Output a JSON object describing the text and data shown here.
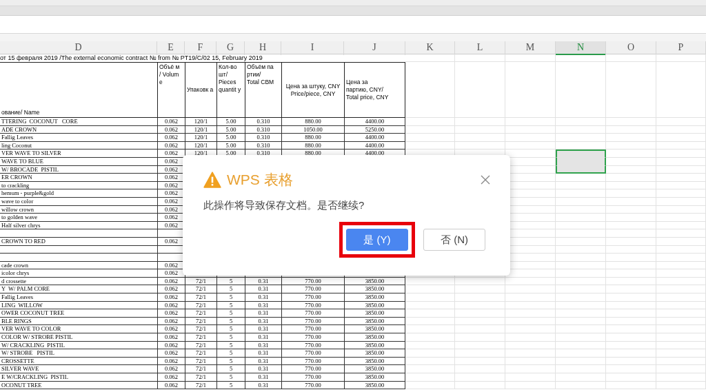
{
  "sheet": {
    "columns": [
      {
        "label": "D",
        "selected": false
      },
      {
        "label": "E",
        "selected": false
      },
      {
        "label": "F",
        "selected": false
      },
      {
        "label": "G",
        "selected": false
      },
      {
        "label": "H",
        "selected": false
      },
      {
        "label": "I",
        "selected": false
      },
      {
        "label": "J",
        "selected": false
      },
      {
        "label": "K",
        "selected": false
      },
      {
        "label": "L",
        "selected": false
      },
      {
        "label": "M",
        "selected": false
      },
      {
        "label": "N",
        "selected": true
      },
      {
        "label": "O",
        "selected": false
      },
      {
        "label": "P",
        "selected": false
      }
    ],
    "title_row": "от 15 февраля 2019 /The external economic contract №  from № PT19/C/02 15, February 2019",
    "headers": [
      "ование/ Name",
      "Объё м\n/ Volum\ne",
      "Упаковк а",
      "Кол-во\nшт/\nPieces\nquantit y",
      "Объём па\nртии/\nTotal CBM",
      "Цена за штуку, CNY\nPrice/piece, CNY",
      "Цена за\nпартию, CNY/\nTotal price, CNY"
    ],
    "rows": [
      {
        "cells": [
          "TTERING  COCONUT   CORE",
          "0.062",
          "120/1",
          "5.00",
          "0.310",
          "880.00",
          "4400.00"
        ],
        "selected": false
      },
      {
        "cells": [
          "ADE CROWN",
          "0.062",
          "120/1",
          "5.00",
          "0.310",
          "1050.00",
          "5250.00"
        ],
        "selected": false
      },
      {
        "cells": [
          "Fallig Leaves",
          "0.062",
          "120/1",
          "5.00",
          "0.310",
          "880.00",
          "4400.00"
        ],
        "selected": false
      },
      {
        "cells": [
          "ling Coconut",
          "0.062",
          "120/1",
          "5.00",
          "0.310",
          "880.00",
          "4400.00"
        ],
        "selected": false
      },
      {
        "cells": [
          "VER WAVE TO SILVER",
          "0.062",
          "120/1",
          "5.00",
          "0.310",
          "880.00",
          "4400.00"
        ],
        "selected": true
      },
      {
        "cells": [
          "WAVE TO BLUE",
          "0.062"
        ],
        "selected": true
      },
      {
        "cells": [
          "W/ BROCADE  PISTIL",
          "0.062"
        ],
        "selected": true
      },
      {
        "cells": [
          "ER CROWN",
          "0.062"
        ],
        "selected": false
      },
      {
        "cells": [
          "to crackling",
          "0.062"
        ],
        "selected": false
      },
      {
        "cells": [
          "hemum - purple&gold",
          "0.062"
        ],
        "selected": false
      },
      {
        "cells": [
          "wave to color",
          "0.062"
        ],
        "selected": false
      },
      {
        "cells": [
          "willow crown",
          "0.062"
        ],
        "selected": false
      },
      {
        "cells": [
          "to golden wave",
          "0.062"
        ],
        "selected": false
      },
      {
        "cells": [
          "Half silver chrys",
          "0.062"
        ],
        "selected": false
      },
      {
        "selected": false
      },
      {
        "cells": [
          "CROWN TO RED",
          "0.062"
        ],
        "selected": false
      },
      {
        "selected": false
      },
      {
        "selected": false
      },
      {
        "cells": [
          "cade crown",
          "0.062"
        ],
        "selected": false
      },
      {
        "cells": [
          "icolor chrys",
          "0.062"
        ],
        "selected": false
      },
      {
        "cells": [
          "d crossette",
          "0.062",
          "72/1",
          "5",
          "0.31",
          "770.00",
          "3850.00"
        ],
        "selected": false
      },
      {
        "cells": [
          "Y  W/ PALM CORE",
          "0.062",
          "72/1",
          "5",
          "0.31",
          "770.00",
          "3850.00"
        ],
        "selected": false
      },
      {
        "cells": [
          "Fallig Leaves",
          "0.062",
          "72/1",
          "5",
          "0.31",
          "770.00",
          "3850.00"
        ],
        "selected": false
      },
      {
        "cells": [
          "LING  WILLOW",
          "0.062",
          "72/1",
          "5",
          "0.31",
          "770.00",
          "3850.00"
        ],
        "selected": false
      },
      {
        "cells": [
          "OWER COCONUT TREE",
          "0.062",
          "72/1",
          "5",
          "0.31",
          "770.00",
          "3850.00"
        ],
        "selected": false
      },
      {
        "cells": [
          "BLE RINGS",
          "0.062",
          "72/1",
          "5",
          "0.31",
          "770.00",
          "3850.00"
        ],
        "selected": false
      },
      {
        "cells": [
          "VER WAVE TO COLOR",
          "0.062",
          "72/1",
          "5",
          "0.31",
          "770.00",
          "3850.00"
        ],
        "selected": false
      },
      {
        "cells": [
          "COLOR W/ STROBE PISTIL",
          "0.062",
          "72/1",
          "5",
          "0.31",
          "770.00",
          "3850.00"
        ],
        "selected": false
      },
      {
        "cells": [
          "W/ CRACKLING  PISTIL",
          "0.062",
          "72/1",
          "5",
          "0.31",
          "770.00",
          "3850.00"
        ],
        "selected": false
      },
      {
        "cells": [
          "W/ STROBE   PISTIL",
          "0.062",
          "72/1",
          "5",
          "0.31",
          "770.00",
          "3850.00"
        ],
        "selected": false
      },
      {
        "cells": [
          "CROSSETTE",
          "0.062",
          "72/1",
          "5",
          "0.31",
          "770.00",
          "3850.00"
        ],
        "selected": false
      },
      {
        "cells": [
          "SILVER WAVE",
          "0.062",
          "72/1",
          "5",
          "0.31",
          "770.00",
          "3850.00"
        ],
        "selected": false
      },
      {
        "cells": [
          "E W/CRACKLING  PISTIL",
          "0.062",
          "72/1",
          "5",
          "0.31",
          "770.00",
          "3850.00"
        ],
        "selected": false
      },
      {
        "cells": [
          "OCONUT TREE",
          "0.062",
          "72/1",
          "5",
          "0.31",
          "770.00",
          "3850.00"
        ],
        "selected": false
      }
    ]
  },
  "dialog": {
    "title": "WPS 表格",
    "message": "此操作将导致保存文档。是否继续?",
    "buttons": [
      {
        "label": "是 (Y)",
        "kind": "primary",
        "highlighted": true
      },
      {
        "label": "否 (N)",
        "kind": "secondary",
        "highlighted": false
      }
    ]
  }
}
